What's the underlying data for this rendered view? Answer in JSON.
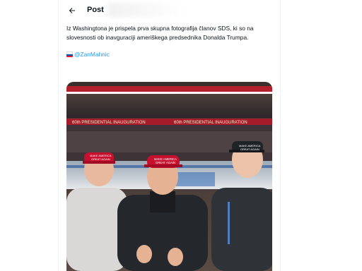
{
  "header": {
    "title": "Post"
  },
  "post": {
    "text": "Iz Washingtona je prispela prva skupna fotografija članov SDS, ki so na slovesnosti ob inavguraciji ameriškega predsednika Donalda Trumpa.",
    "mention": "@ZanMahnic",
    "mention_icon": "slovenia-flag-icon"
  },
  "photo": {
    "banner_left": "60th PRESIDENTIAL INAUGURATION",
    "banner_mid": "60th PRESIDENTIAL INAUGURATION",
    "hat_line1": "MAKE AMERICA",
    "hat_line2": "GREAT AGAIN",
    "hat_color": "#c8102e"
  },
  "colors": {
    "link": "#1d9bf0",
    "text": "#0f1419"
  }
}
